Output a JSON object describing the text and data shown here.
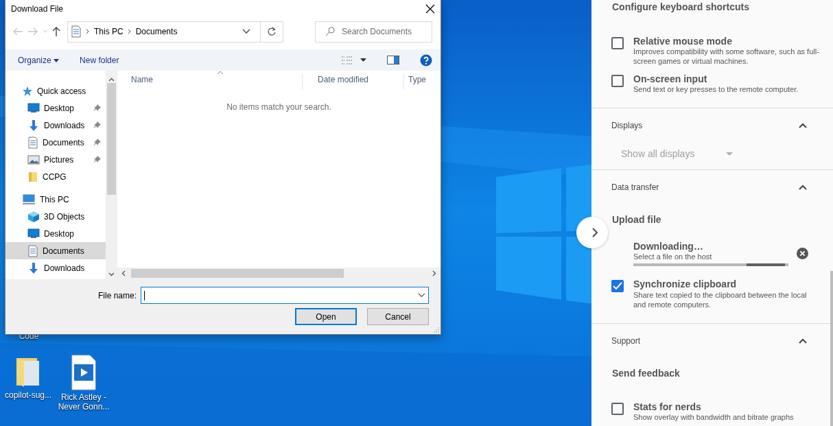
{
  "desktop_icons": [
    {
      "label": "Code",
      "kind": "hidden"
    },
    {
      "label": "copilot-sug...",
      "kind": "folder"
    },
    {
      "label": "Rick Astley - Never Gonn...",
      "kind": "video"
    }
  ],
  "dialog": {
    "title": "Download File",
    "path": [
      "This PC",
      "Documents"
    ],
    "search": {
      "placeholder": "Search Documents"
    },
    "toolbar": [
      "Organize",
      "New folder"
    ],
    "tree": [
      {
        "label": "Quick access",
        "kind": "star",
        "children": [
          {
            "label": "Desktop",
            "kind": "desktop",
            "pinned": true,
            "selected": false
          },
          {
            "label": "Downloads",
            "kind": "downloads",
            "pinned": true,
            "selected": false
          },
          {
            "label": "Documents",
            "kind": "documents",
            "pinned": true,
            "selected": false
          },
          {
            "label": "Pictures",
            "kind": "pictures",
            "pinned": true,
            "selected": false
          },
          {
            "label": "CCPG",
            "kind": "folder",
            "pinned": false,
            "selected": false
          }
        ]
      },
      {
        "label": "This PC",
        "kind": "pc",
        "children": [
          {
            "label": "3D Objects",
            "kind": "cube",
            "selected": false
          },
          {
            "label": "Desktop",
            "kind": "desktop",
            "selected": false
          },
          {
            "label": "Documents",
            "kind": "documents",
            "selected": true
          },
          {
            "label": "Downloads",
            "kind": "downloads",
            "selected": false
          }
        ]
      }
    ],
    "columns": [
      "Name",
      "Date modified",
      "Type"
    ],
    "empty_message": "No items match your search.",
    "file_name": {
      "label": "File name:",
      "focused": true
    },
    "buttons": [
      {
        "label": "Open",
        "default": true
      },
      {
        "label": "Cancel",
        "default": false
      }
    ]
  },
  "panel": {
    "items": [
      {
        "kind": "link",
        "label": "Configure keyboard shortcuts"
      },
      {
        "kind": "checkbox",
        "label": "Relative mouse mode",
        "description": "Improves compatibility with some software, such as full-screen games or virtual machines.",
        "checked": false
      },
      {
        "kind": "checkbox",
        "label": "On-screen input",
        "description": "Send text or key presses to the remote computer.",
        "checked": false
      },
      {
        "kind": "section",
        "label": "Displays",
        "expanded": true
      },
      {
        "kind": "select",
        "label": "Show all displays",
        "disabled": true
      },
      {
        "kind": "section",
        "label": "Data transfer",
        "expanded": true
      },
      {
        "kind": "link",
        "label": "Upload file"
      },
      {
        "kind": "progress",
        "label": "Downloading…",
        "description": "Select a file on the host",
        "level": 0.73
      },
      {
        "kind": "checkbox",
        "label": "Synchronize clipboard",
        "description": "Share text copied to the clipboard between the local and remote computers.",
        "checked": true
      },
      {
        "kind": "section",
        "label": "Support",
        "expanded": true
      },
      {
        "kind": "link",
        "label": "Send feedback"
      },
      {
        "kind": "checkbox",
        "label": "Stats for nerds",
        "description": "Show overlay with bandwidth and bitrate graphs",
        "checked": false
      }
    ]
  }
}
